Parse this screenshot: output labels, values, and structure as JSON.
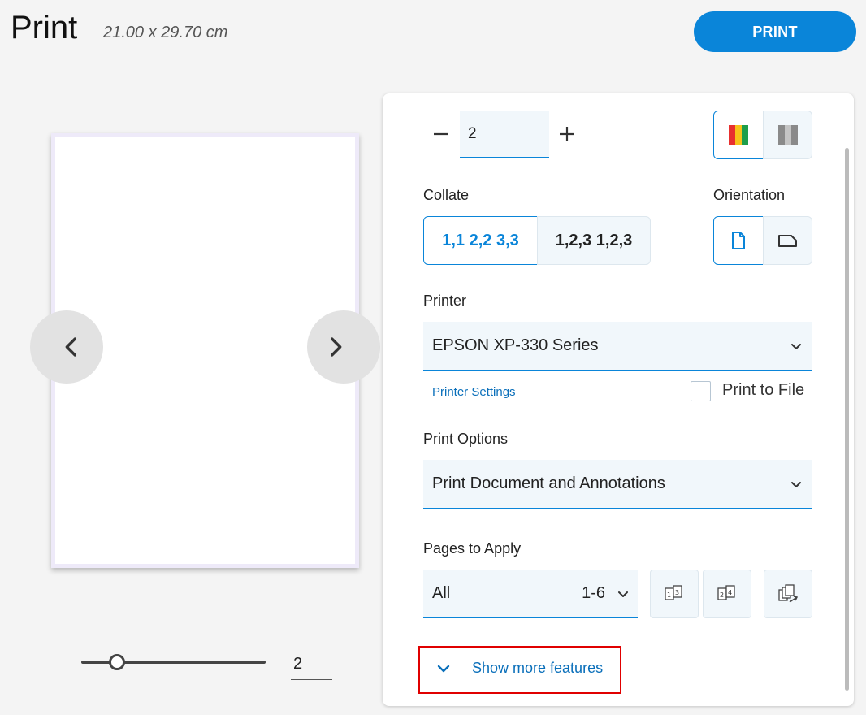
{
  "header": {
    "title": "Print",
    "page_size": "21.00 x 29.70 cm",
    "print_button_label": "PRINT"
  },
  "preview": {
    "prev_icon": "chevron-left-icon",
    "next_icon": "chevron-right-icon",
    "zoom_value": "2",
    "zoom_slider_fraction": 0.15
  },
  "settings": {
    "copies": {
      "value": "2",
      "minus_icon": "minus-icon",
      "plus_icon": "plus-icon"
    },
    "color_mode": {
      "options": [
        "color-icon",
        "grayscale-icon"
      ],
      "selected": "color"
    },
    "collate": {
      "label": "Collate",
      "options": [
        "1,1 2,2 3,3",
        "1,2,3 1,2,3"
      ],
      "selected": 0
    },
    "orientation": {
      "label": "Orientation",
      "options": [
        "portrait-icon",
        "landscape-icon"
      ],
      "selected": "portrait"
    },
    "printer": {
      "label": "Printer",
      "value": "EPSON XP-330 Series",
      "settings_link": "Printer Settings",
      "print_to_file_label": "Print to File",
      "print_to_file_checked": false
    },
    "print_options": {
      "label": "Print Options",
      "value": "Print Document and Annotations"
    },
    "pages": {
      "label": "Pages to Apply",
      "value": "All",
      "range": "1-6",
      "buttons": [
        "odd-pages-icon",
        "even-pages-icon",
        "reverse-order-icon"
      ]
    },
    "more_features": "Show more features"
  },
  "colors": {
    "accent": "#0a85d9",
    "link": "#0a6fba",
    "highlight_border": "#e00000",
    "field_bg": "#f1f7fb"
  }
}
